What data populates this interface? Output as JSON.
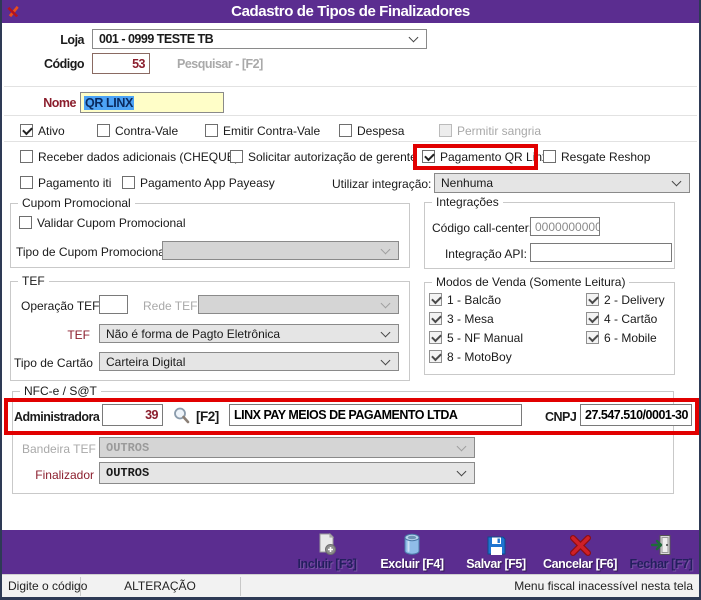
{
  "window": {
    "title": "Cadastro de Tipos de Finalizadores"
  },
  "header": {
    "loja_label": "Loja",
    "loja_value": "001 - 0999 TESTE TB",
    "codigo_label": "Código",
    "codigo_value": "53",
    "pesquisar_hint": "Pesquisar - [F2]",
    "nome_label": "Nome",
    "nome_value": "QR LINX"
  },
  "flags": {
    "ativo": {
      "label": "Ativo",
      "checked": true
    },
    "contra_vale": {
      "label": "Contra-Vale",
      "checked": false
    },
    "emitir_contra_vale": {
      "label": "Emitir Contra-Vale",
      "checked": false
    },
    "despesa": {
      "label": "Despesa",
      "checked": false
    },
    "permitir_sangria": {
      "label": "Permitir sangria",
      "checked": false
    },
    "receber_dados": {
      "label": "Receber dados adicionais (CHEQUE)",
      "checked": false
    },
    "solicitar_autorizacao": {
      "label": "Solicitar autorização de gerente",
      "checked": false
    },
    "pagamento_qr_linx": {
      "label": "Pagamento QR Linx",
      "checked": true
    },
    "resgate_reshop": {
      "label": "Resgate Reshop",
      "checked": false
    },
    "pagamento_iti": {
      "label": "Pagamento iti",
      "checked": false
    },
    "pagamento_app_payeasy": {
      "label": "Pagamento App Payeasy",
      "checked": false
    }
  },
  "integracao_select": {
    "label": "Utilizar integração:",
    "value": "Nenhuma"
  },
  "cupom": {
    "title": "Cupom Promocional",
    "validar": {
      "label": "Validar Cupom Promocional",
      "checked": false
    },
    "tipo_label": "Tipo de Cupom Promocional",
    "tipo_value": ""
  },
  "integracoes": {
    "title": "Integrações",
    "call_center_label": "Código call-center:",
    "call_center_value": "0000000000",
    "api_label": "Integração API:",
    "api_value": ""
  },
  "tef": {
    "title": "TEF",
    "operacao_label": "Operação TEF",
    "operacao_value": "",
    "rede_label": "Rede TEF",
    "rede_value": "",
    "tef_label": "TEF",
    "tef_value": "Não é forma de Pagto Eletrônica",
    "tipo_cartao_label": "Tipo de Cartão",
    "tipo_cartao_value": "Carteira Digital"
  },
  "modos": {
    "title": "Modos de Venda (Somente Leitura)",
    "items": [
      {
        "label": "1 - Balcão",
        "checked": true
      },
      {
        "label": "2 - Delivery",
        "checked": true
      },
      {
        "label": "3 - Mesa",
        "checked": true
      },
      {
        "label": "4 - Cartão",
        "checked": true
      },
      {
        "label": "5 - NF Manual",
        "checked": true
      },
      {
        "label": "6 - Mobile",
        "checked": true
      },
      {
        "label": "8 - MotoBoy",
        "checked": true
      }
    ]
  },
  "nfce": {
    "title": "NFC-e / S@T",
    "administradora_label": "Administradora",
    "administradora_codigo": "39",
    "f2_hint": "[F2]",
    "administradora_nome": "LINX PAY MEIOS DE PAGAMENTO LTDA",
    "cnpj_label": "CNPJ",
    "cnpj_value": "27.547.510/0001-30",
    "bandeira_label": "Bandeira TEF",
    "bandeira_value": "OUTROS",
    "finalizador_label": "Finalizador",
    "finalizador_value": "OUTROS"
  },
  "toolbar": {
    "incluir": "Incluir [F3]",
    "excluir": "Excluir [F4]",
    "salvar": "Salvar [F5]",
    "cancelar": "Cancelar [F6]",
    "fechar": "Fechar [F7]"
  },
  "statusbar": {
    "left": "Digite o código",
    "mode": "ALTERAÇÃO",
    "right": "Menu fiscal inacessível nesta tela"
  },
  "colors": {
    "title_purple": "#5b2d90",
    "annotation_red": "#e10000",
    "label_maroon": "#8b1e2d",
    "field_yellow": "#fffec8",
    "selection_blue": "#4da3f5"
  }
}
